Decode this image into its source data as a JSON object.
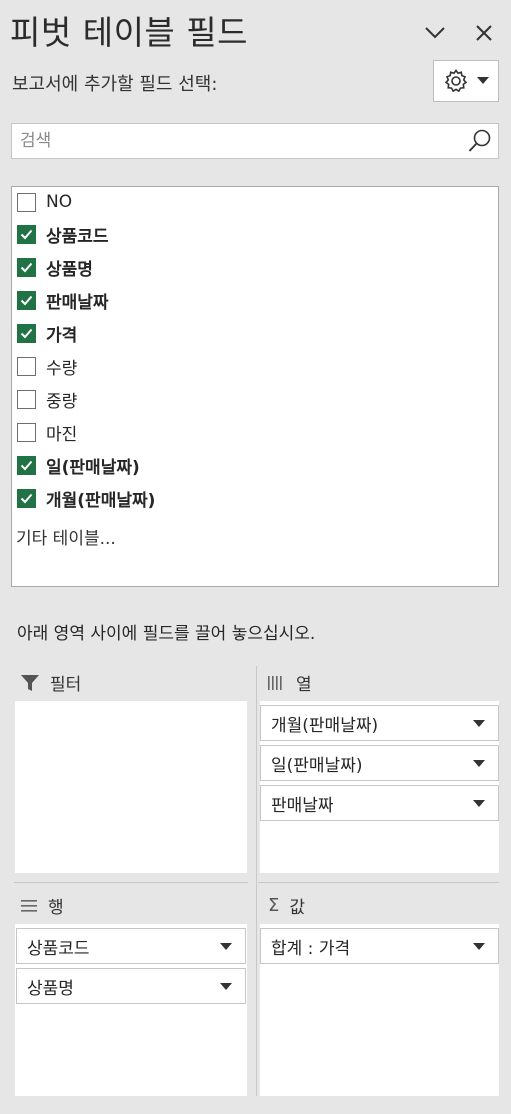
{
  "header": {
    "title": "피벗 테이블 필드",
    "subtitle": "보고서에 추가할 필드 선택:"
  },
  "search": {
    "placeholder": "검색",
    "value": ""
  },
  "fields": [
    {
      "label": "NO",
      "checked": false
    },
    {
      "label": "상품코드",
      "checked": true
    },
    {
      "label": "상품명",
      "checked": true
    },
    {
      "label": "판매날짜",
      "checked": true
    },
    {
      "label": "가격",
      "checked": true
    },
    {
      "label": "수량",
      "checked": false
    },
    {
      "label": "중량",
      "checked": false
    },
    {
      "label": "마진",
      "checked": false
    },
    {
      "label": "일(판매날짜)",
      "checked": true
    },
    {
      "label": "개월(판매날짜)",
      "checked": true
    }
  ],
  "more_tables": "기타 테이블...",
  "instruction": "아래 영역 사이에 필드를 끌어 놓으십시오.",
  "areas": {
    "filter": {
      "label": "필터",
      "icon": "filter-icon",
      "items": []
    },
    "columns": {
      "label": "열",
      "icon": "columns-icon",
      "items": [
        "개월(판매날짜)",
        "일(판매날짜)",
        "판매날짜"
      ]
    },
    "rows": {
      "label": "행",
      "icon": "rows-icon",
      "items": [
        "상품코드",
        "상품명"
      ]
    },
    "values": {
      "label": "값",
      "icon": "sigma-icon",
      "items": [
        "합계 : 가격"
      ]
    }
  },
  "colors": {
    "panel_bg": "#e6e6e6",
    "checkbox_checked": "#217346"
  }
}
